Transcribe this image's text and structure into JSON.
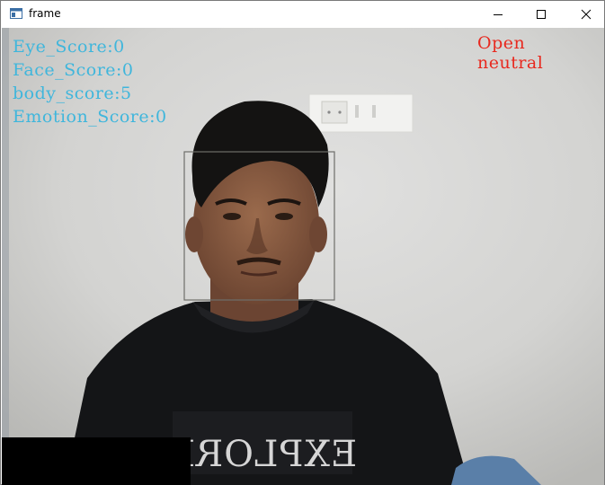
{
  "window": {
    "title": "frame",
    "icons": {
      "app": "app-window-icon",
      "minimize": "minimize-icon",
      "maximize": "maximize-icon",
      "close": "close-icon"
    }
  },
  "overlay": {
    "scores": [
      "Eye_Score:0",
      "Face_Score:0",
      "body_score:5",
      "Emotion_Score:0"
    ],
    "eye_state": "Open",
    "emotion": "neutral",
    "colors": {
      "scores": "#3fb6dc",
      "status": "#e8291f",
      "face_box": "#6e6e6a"
    }
  }
}
